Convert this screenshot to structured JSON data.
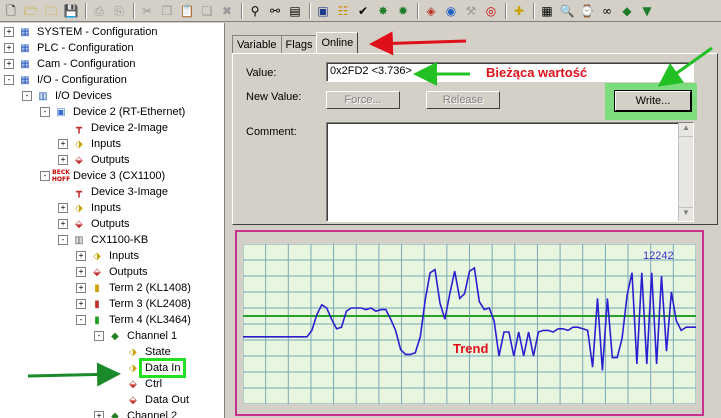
{
  "toolbar": {
    "icons": [
      "new-icon",
      "open-icon",
      "open-folder-icon",
      "save-icon",
      "print-icon",
      "print-preview-icon",
      "cut-icon",
      "copy-icon",
      "paste-icon",
      "paste-special-icon",
      "delete-icon",
      "find-icon",
      "find-next-icon",
      "properties-icon",
      "monitor-icon",
      "generate-mappings-icon",
      "check-icon",
      "activate-config-icon",
      "set-run-mode-icon",
      "network-scan-icon",
      "broadcast-icon",
      "tools-icon",
      "target-icon",
      "plus-icon",
      "grid-icon",
      "zoom-icon",
      "watch-icon",
      "glasses-icon",
      "force-icon",
      "bookmark-icon"
    ]
  },
  "tree": {
    "items": [
      {
        "label": "SYSTEM - Configuration",
        "icon": "system-icon"
      },
      {
        "label": "PLC - Configuration",
        "icon": "plc-icon"
      },
      {
        "label": "Cam - Configuration",
        "icon": "cam-icon"
      },
      {
        "label": "I/O - Configuration",
        "icon": "io-icon"
      },
      {
        "label": "I/O Devices",
        "icon": "devices-icon"
      },
      {
        "label": "Device 2 (RT-Ethernet)",
        "icon": "ethernet-device-icon"
      },
      {
        "label": "Device 2-Image",
        "icon": "image-icon"
      },
      {
        "label": "Inputs",
        "icon": "inputs-icon"
      },
      {
        "label": "Outputs",
        "icon": "outputs-icon"
      },
      {
        "label": "Device 3 (CX1100)",
        "icon": "beckhoff-device-icon",
        "badge_top": "BECK",
        "badge_bottom": "HOFF"
      },
      {
        "label": "Device 3-Image",
        "icon": "image-icon"
      },
      {
        "label": "Inputs",
        "icon": "inputs-icon"
      },
      {
        "label": "Outputs",
        "icon": "outputs-icon"
      },
      {
        "label": "CX1100-KB",
        "icon": "coupler-icon"
      },
      {
        "label": "Inputs",
        "icon": "inputs-icon"
      },
      {
        "label": "Outputs",
        "icon": "outputs-icon"
      },
      {
        "label": "Term 2 (KL1408)",
        "icon": "terminal-yellow-icon"
      },
      {
        "label": "Term 3 (KL2408)",
        "icon": "terminal-red-icon"
      },
      {
        "label": "Term 4 (KL3464)",
        "icon": "terminal-green-icon"
      },
      {
        "label": "Channel 1",
        "icon": "channel-icon"
      },
      {
        "label": "State",
        "icon": "variable-input-icon"
      },
      {
        "label": "Data In",
        "icon": "variable-input-icon"
      },
      {
        "label": "Ctrl",
        "icon": "variable-output-icon"
      },
      {
        "label": "Data Out",
        "icon": "variable-output-icon"
      },
      {
        "label": "Channel 2",
        "icon": "channel-icon"
      }
    ]
  },
  "tabs": [
    {
      "label": "Variable"
    },
    {
      "label": "Flags"
    },
    {
      "label": "Online"
    }
  ],
  "online": {
    "value_label": "Value:",
    "value": "0x2FD2 <3.736>",
    "new_value_label": "New Value:",
    "force_label": "Force...",
    "release_label": "Release",
    "write_label": "Write...",
    "comment_label": "Comment:",
    "comment": ""
  },
  "annotations": {
    "current_value": "Bieżąca wartość",
    "trend": "Trend"
  },
  "trend": {
    "readout": "12242",
    "colors": {
      "background": "#e8f6e0",
      "grid": "#7aa8b5",
      "signal": "#2a1fd0",
      "baseline": "#2aa02a"
    }
  },
  "chart_data": {
    "type": "line",
    "series": [
      {
        "values": [
          4.2,
          4.2,
          4.2,
          4.2,
          4.2,
          4.2,
          4.2,
          4.2,
          4.2,
          4.2,
          4.2,
          4.2,
          4.2,
          4.2,
          4.6,
          5.6,
          6.2,
          6.0,
          5.3,
          4.7,
          4.8,
          5.8,
          6.0,
          6.0,
          6.0,
          5.9,
          6.0,
          5.8,
          5.9,
          5.9,
          5.3,
          4.6,
          3.4,
          3.1,
          3.1,
          3.2,
          4.2,
          6.5,
          8.2,
          8.4,
          6.3,
          5.3,
          6.9,
          8.3,
          6.6,
          6.9,
          8.3,
          8.5,
          6.4,
          5.9,
          6.0,
          5.2,
          3.0,
          4.5,
          4.5,
          3.0,
          4.5,
          3.0,
          4.5,
          3.0,
          4.5,
          4.6,
          4.6,
          4.5,
          4.7,
          4.7,
          4.6,
          4.8,
          4.8,
          4.7,
          4.6,
          2.3,
          6.6,
          2.1,
          6.6,
          2.9,
          2.9,
          4.1,
          6.8,
          8.2,
          2.5,
          8.2,
          2.5,
          8.2,
          2.5,
          8.0,
          3.3,
          7.0,
          5.2,
          4.6,
          4.8,
          4.8,
          4.8
        ]
      }
    ]
  }
}
